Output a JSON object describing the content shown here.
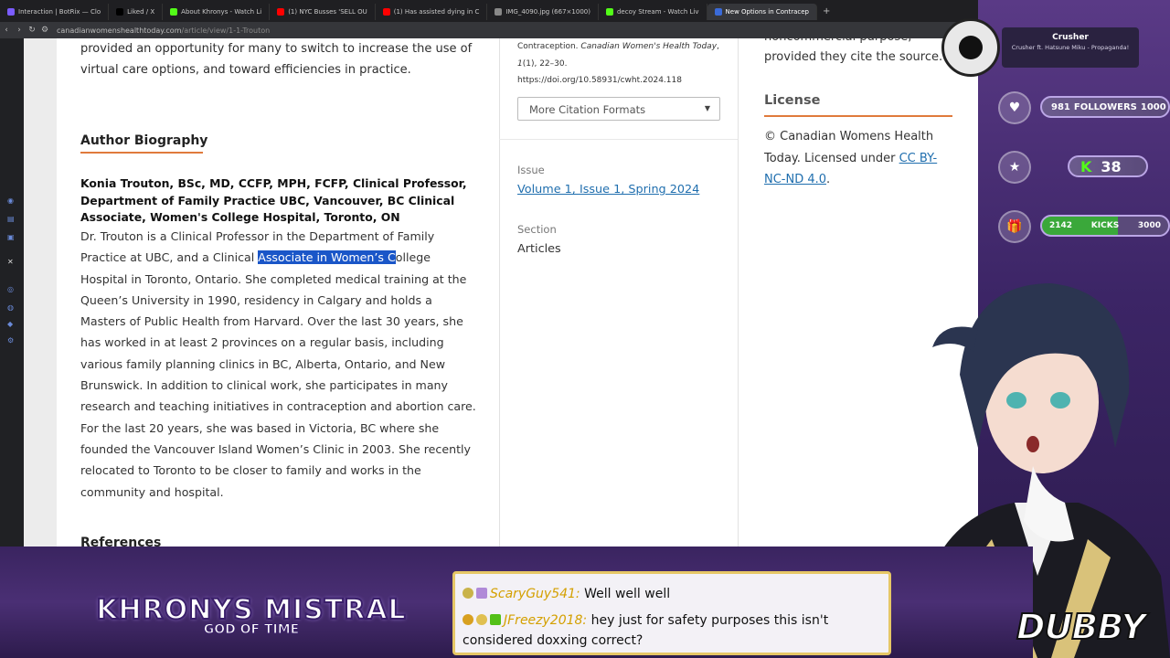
{
  "browser": {
    "tabs": [
      {
        "label": "Interaction | BotRix — Clo",
        "favicon": "#7b5cff"
      },
      {
        "label": "Liked / X",
        "favicon": "#000000"
      },
      {
        "label": "About Khronys - Watch Li",
        "favicon": "#53fc18"
      },
      {
        "label": "(1) NYC Busses 'SELL OU",
        "favicon": "#ff0000"
      },
      {
        "label": "(1) Has assisted dying in C",
        "favicon": "#ff0000"
      },
      {
        "label": "IMG_4090.jpg (667×1000)",
        "favicon": "#888888"
      },
      {
        "label": "decoy Stream - Watch Liv",
        "favicon": "#53fc18"
      },
      {
        "label": "New Options in Contracep",
        "favicon": "#3a6ad8",
        "active": true
      }
    ],
    "url_host": "canadianwomenshealthtoday.com",
    "url_path": "/article/view/1-1-Trouton"
  },
  "article": {
    "intro": "provided an opportunity for many to switch to increase the use of virtual care options, and toward efficiencies in practice.",
    "bio_heading": "Author Biography",
    "bio_name": "Konia Trouton, BSc, MD, CCFP, MPH, FCFP, Clinical Professor, Department of Family Practice UBC, Vancouver, BC Clinical Associate, Women's College Hospital, Toronto, ON",
    "bio_pre": "Dr. Trouton is a Clinical Professor in the Department of Family Practice at UBC, and a Clinical ",
    "bio_highlight": "Associate in Women’s C",
    "bio_post": "ollege Hospital in Toronto, Ontario. She completed medical training at the Queen’s University in 1990, residency in Calgary and holds a Masters of Public Health from Harvard. Over the last 30 years, she has worked in at least 2 provinces on a regular basis, including various family planning clinics in BC, Alberta, Ontario, and New Brunswick. In addition to clinical work, she participates in many research and teaching initiatives in contraception and abortion care. For the last 20 years, she was based in Victoria, BC where she founded the Vancouver Island Women’s Clinic in 2003. She recently relocated to Toronto to be closer to family and works in the community and hospital.",
    "references_heading": "References"
  },
  "sidebar_mid": {
    "cite_line1_plain": "Contraception. ",
    "cite_line1_italic": "Canadian Women's Health Today",
    "cite_line1_end": ",",
    "cite_line2_italic": "1",
    "cite_line2_end": "(1), 22–30.",
    "cite_doi": "https://doi.org/10.58931/cwht.2024.118",
    "more_formats": "More Citation Formats",
    "issue_label": "Issue",
    "issue_value": "Volume 1, Issue 1, Spring 2024",
    "section_label": "Section",
    "section_value": "Articles"
  },
  "sidebar_right": {
    "top_line1": "noncommercial purpose,",
    "top_line2": "provided they cite the source.",
    "license_heading": "License",
    "license_text": "© Canadian Womens Health Today. Licensed under ",
    "license_link": "CC BY-NC-ND 4.0",
    "license_end": "."
  },
  "overlay": {
    "profile_name": "Crusher",
    "profile_song": "Crusher ft. Hatsune Miku - Propaganda!",
    "followers_current": "981",
    "followers_label": "FOLLOWERS",
    "followers_goal": "1000",
    "kick_count": "38",
    "kicks_current": "2142",
    "kicks_label": "KICKS",
    "kicks_goal": "3000",
    "title_main": "KHRONYS MISTRAL",
    "title_sub": "GOD OF TIME",
    "watermark": "DUBBY",
    "chat": [
      {
        "user": "ScaryGuy541:",
        "user_color": "#e2a800",
        "message": "Well well well"
      },
      {
        "user": "JFreezy2018:",
        "user_color": "#e2a800",
        "message": "hey just for safety purposes this isn't considered doxxing correct?"
      }
    ]
  },
  "colors": {
    "accent_orange": "#e07a3c",
    "link_blue": "#1f6eae",
    "selection": "#1a56c8"
  }
}
